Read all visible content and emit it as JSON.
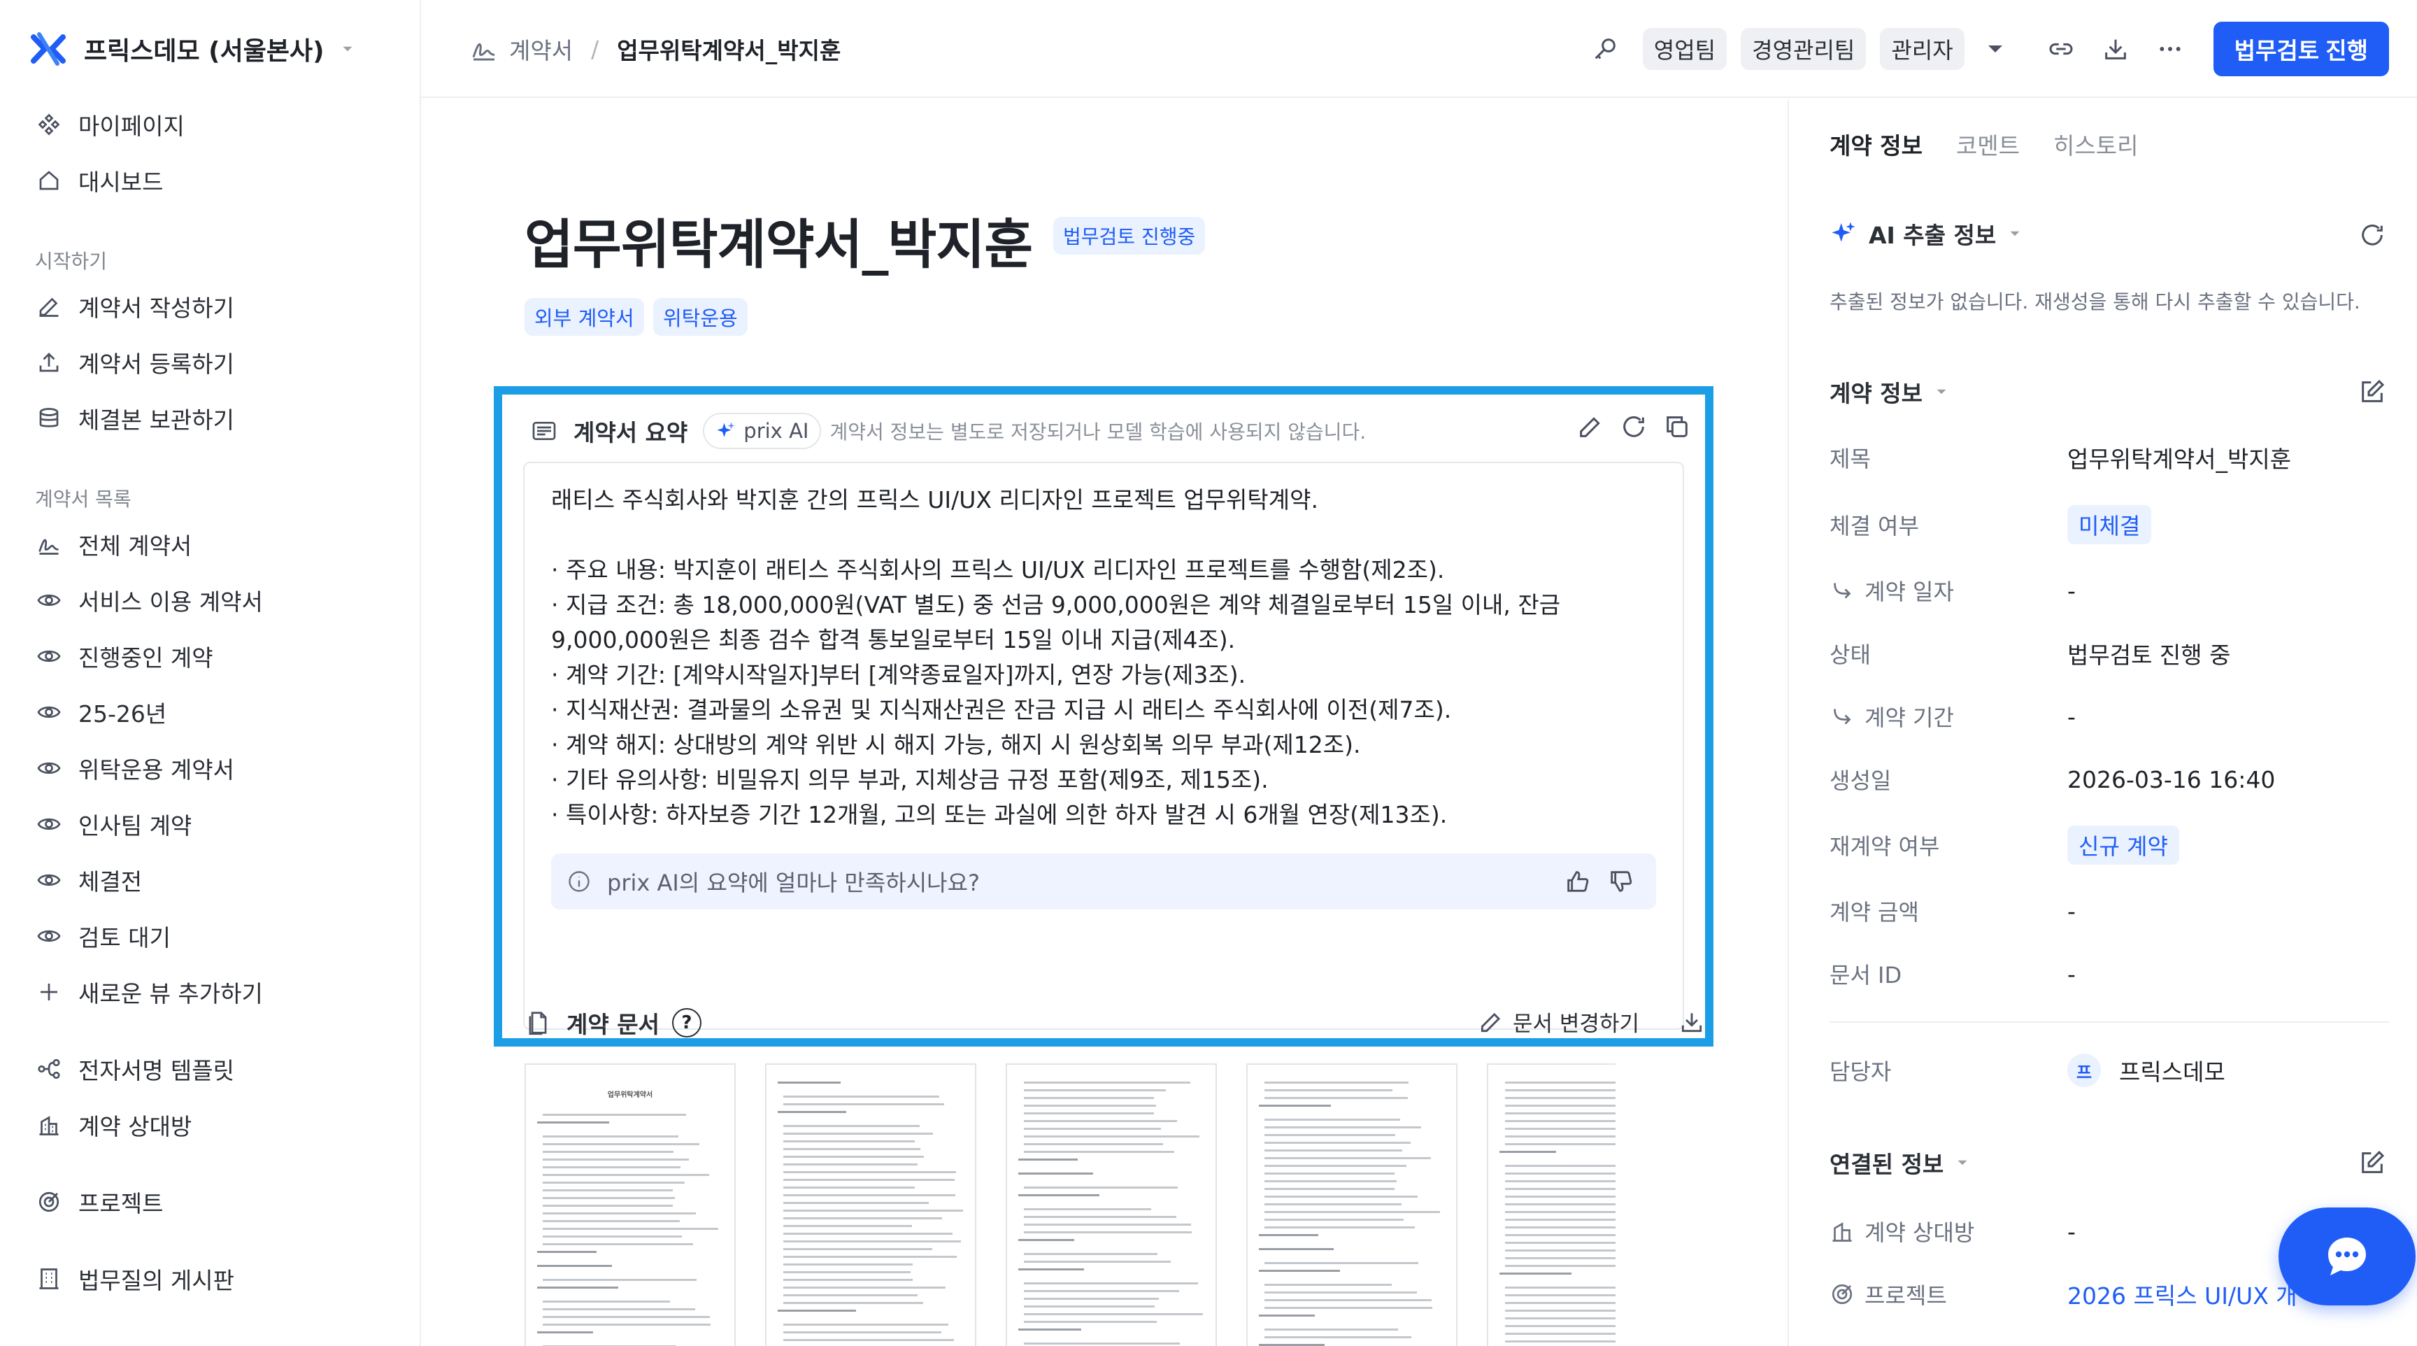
{
  "colors": {
    "primary": "#1f5df6",
    "highlight_border": "#1b9ee6",
    "pill_bg": "#eaf1ff",
    "text": "#1f2329",
    "muted": "#6b7280"
  },
  "sidebar": {
    "org_name": "프릭스데모 (서울본사)",
    "top_items": [
      {
        "label": "마이페이지",
        "icon": "diamond-grid-icon"
      },
      {
        "label": "대시보드",
        "icon": "home-icon"
      }
    ],
    "section_start": "시작하기",
    "start_items": [
      {
        "label": "계약서 작성하기",
        "icon": "pencil-icon"
      },
      {
        "label": "계약서 등록하기",
        "icon": "upload-icon"
      },
      {
        "label": "체결본 보관하기",
        "icon": "database-icon"
      }
    ],
    "section_list": "계약서 목록",
    "list_items": [
      {
        "label": "전체 계약서",
        "icon": "signature-icon"
      },
      {
        "label": "서비스 이용 계약서",
        "icon": "eye-icon"
      },
      {
        "label": "진행중인 계약",
        "icon": "eye-icon"
      },
      {
        "label": "25-26년",
        "icon": "eye-icon"
      },
      {
        "label": "위탁운용 계약서",
        "icon": "eye-icon"
      },
      {
        "label": "인사팀 계약",
        "icon": "eye-icon"
      },
      {
        "label": "체결전",
        "icon": "eye-icon"
      },
      {
        "label": "검토 대기",
        "icon": "eye-icon"
      },
      {
        "label": "새로운 뷰 추가하기",
        "icon": "plus-icon"
      }
    ],
    "extra_items": [
      {
        "label": "전자서명 템플릿",
        "icon": "flow-icon"
      },
      {
        "label": "계약 상대방",
        "icon": "building-icon"
      },
      {
        "label": "프로젝트",
        "icon": "target-icon"
      },
      {
        "label": "법무질의 게시판",
        "icon": "office-icon"
      }
    ]
  },
  "header": {
    "breadcrumb_parent": "계약서",
    "breadcrumb_separator": "/",
    "breadcrumb_current": "업무위탁계약서_박지훈",
    "team_chips": [
      "영업팀",
      "경영관리팀",
      "관리자"
    ],
    "primary_button": "법무검토 진행"
  },
  "document": {
    "title": "업무위탁계약서_박지훈",
    "status": "법무검토 진행중",
    "tags": [
      "외부 계약서",
      "위탁운용"
    ]
  },
  "summary": {
    "title": "계약서 요약",
    "ai_badge": "prix AI",
    "privacy_note": "계약서 정보는 별도로 저장되거나 모델 학습에 사용되지 않습니다.",
    "intro": "래티스 주식회사와 박지훈 간의 프릭스 UI/UX 리디자인 프로젝트 업무위탁계약.",
    "bullets": [
      "· 주요 내용: 박지훈이 래티스 주식회사의 프릭스 UI/UX 리디자인 프로젝트를 수행함(제2조).",
      "· 지급 조건: 총 18,000,000원(VAT 별도) 중 선금 9,000,000원은 계약 체결일로부터 15일 이내, 잔금 9,000,000원은 최종 검수 합격 통보일로부터 15일 이내 지급(제4조).",
      "· 계약 기간: [계약시작일자]부터 [계약종료일자]까지, 연장 가능(제3조).",
      "· 지식재산권: 결과물의 소유권 및 지식재산권은 잔금 지급 시 래티스 주식회사에 이전(제7조).",
      "· 계약 해지: 상대방의 계약 위반 시 해지 가능, 해지 시 원상회복 의무 부과(제12조).",
      "· 기타 유의사항: 비밀유지 의무 부과, 지체상금 규정 포함(제9조, 제15조).",
      "· 특이사항: 하자보증 기간 12개월, 고의 또는 과실에 의한 하자 발견 시 6개월 연장(제13조)."
    ],
    "feedback_prompt": "prix AI의 요약에 얼마나 만족하시나요?"
  },
  "docs": {
    "title": "계약 문서",
    "help": "?",
    "change_label": "문서 변경하기",
    "thumb_title": "업무위탁계약서"
  },
  "right_panel": {
    "tabs": [
      "계약 정보",
      "코멘트",
      "히스토리"
    ],
    "ai_section_title": "AI 추출 정보",
    "ai_empty": "추출된 정보가 없습니다. 재생성을 통해 다시 추출할 수 있습니다.",
    "contract_section_title": "계약 정보",
    "fields": {
      "title_label": "제목",
      "title_value": "업무위탁계약서_박지훈",
      "signed_label": "체결 여부",
      "signed_value": "미체결",
      "date_label": "계약 일자",
      "date_value": "-",
      "state_label": "상태",
      "state_value": "법무검토 진행 중",
      "period_label": "계약 기간",
      "period_value": "-",
      "created_label": "생성일",
      "created_value": "2026-03-16 16:40",
      "renew_label": "재계약 여부",
      "renew_value": "신규 계약",
      "amount_label": "계약 금액",
      "amount_value": "-",
      "docid_label": "문서 ID",
      "docid_value": "-",
      "owner_label": "담당자",
      "owner_avatar": "프",
      "owner_value": "프릭스데모"
    },
    "linked_section_title": "연결된 정보",
    "linked": {
      "party_label": "계약 상대방",
      "party_value": "-",
      "project_label": "프로젝트",
      "project_value": "2026 프릭스 UI/UX 개"
    }
  }
}
